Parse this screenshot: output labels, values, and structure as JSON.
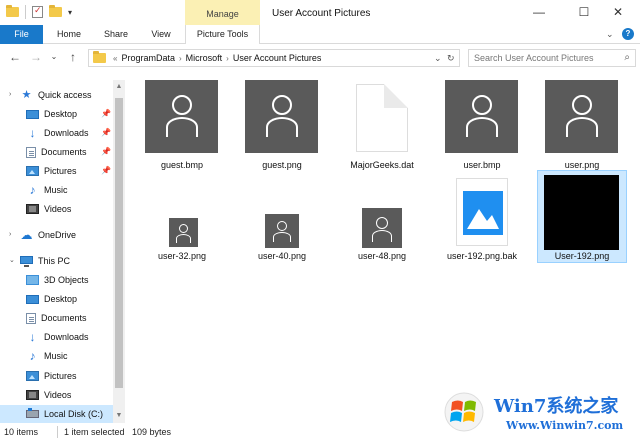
{
  "window": {
    "title": "User Account Pictures",
    "contextual_group": "Manage",
    "controls": {
      "minimize": "—",
      "maximize": "☐",
      "close": "✕"
    }
  },
  "ribbon": {
    "tabs": [
      "File",
      "Home",
      "Share",
      "View",
      "Picture Tools"
    ],
    "help": "?"
  },
  "address": {
    "prefix": "«",
    "crumbs": [
      "ProgramData",
      "Microsoft",
      "User Account Pictures"
    ],
    "search_placeholder": "Search User Account Pictures"
  },
  "nav": {
    "items": [
      {
        "label": "Quick access",
        "icon": "star-icon"
      },
      {
        "label": "Desktop",
        "icon": "desktop-icon",
        "pinned": true
      },
      {
        "label": "Downloads",
        "icon": "download-icon",
        "pinned": true
      },
      {
        "label": "Documents",
        "icon": "documents-icon",
        "pinned": true
      },
      {
        "label": "Pictures",
        "icon": "pictures-icon",
        "pinned": true
      },
      {
        "label": "Music",
        "icon": "music-icon"
      },
      {
        "label": "Videos",
        "icon": "videos-icon"
      },
      {
        "label": "OneDrive",
        "icon": "onedrive-icon"
      },
      {
        "label": "This PC",
        "icon": "this-pc-icon"
      },
      {
        "label": "3D Objects",
        "icon": "3d-objects-icon"
      },
      {
        "label": "Desktop",
        "icon": "desktop-icon"
      },
      {
        "label": "Documents",
        "icon": "documents-icon"
      },
      {
        "label": "Downloads",
        "icon": "download-icon"
      },
      {
        "label": "Music",
        "icon": "music-icon"
      },
      {
        "label": "Pictures",
        "icon": "pictures-icon"
      },
      {
        "label": "Videos",
        "icon": "videos-icon"
      },
      {
        "label": "Local Disk (C:)",
        "icon": "local-disk-icon",
        "selected": true
      }
    ]
  },
  "files": [
    {
      "name": "guest.bmp",
      "kind": "user-large"
    },
    {
      "name": "guest.png",
      "kind": "user-large"
    },
    {
      "name": "MajorGeeks.dat",
      "kind": "document"
    },
    {
      "name": "user.bmp",
      "kind": "user-large"
    },
    {
      "name": "user.png",
      "kind": "user-large"
    },
    {
      "name": "user-32.png",
      "kind": "user-small"
    },
    {
      "name": "user-40.png",
      "kind": "user-small"
    },
    {
      "name": "user-48.png",
      "kind": "user-small"
    },
    {
      "name": "user-192.png.bak",
      "kind": "image"
    },
    {
      "name": "User-192.png",
      "kind": "black-image",
      "selected": true
    }
  ],
  "status": {
    "count": "10 items",
    "selection": "1 item selected",
    "size": "109 bytes"
  },
  "watermark": {
    "line1": "Win7系统之家",
    "line2": "Www.Winwin7.com"
  }
}
